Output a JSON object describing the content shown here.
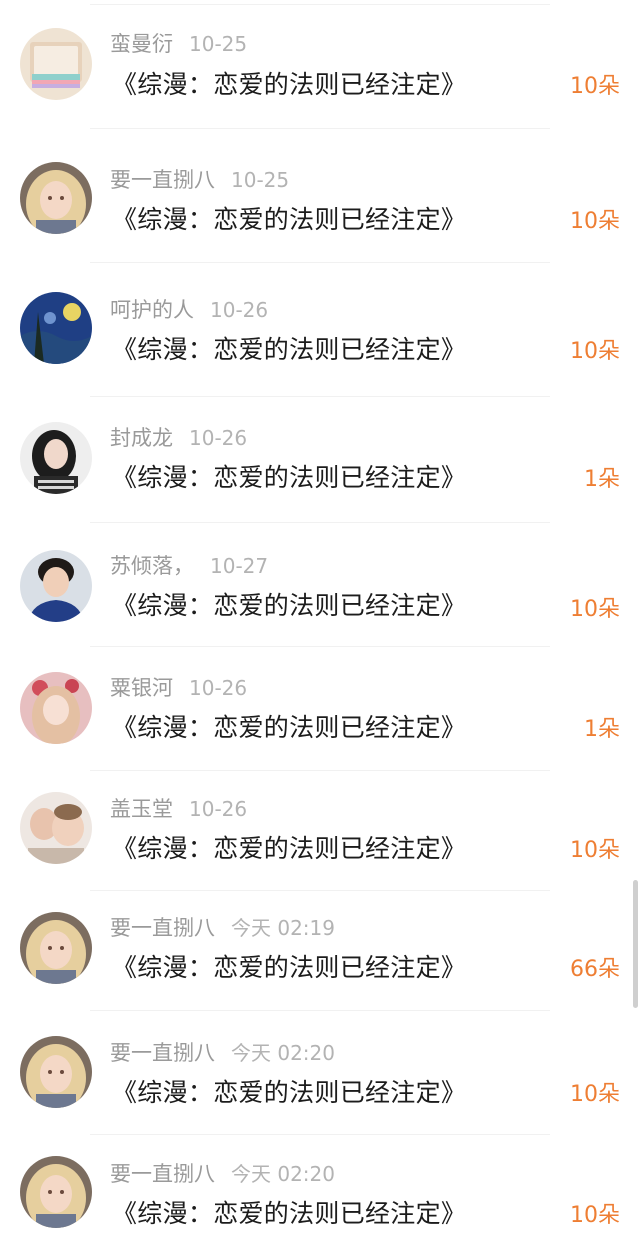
{
  "records": [
    {
      "user": "蛮曼衍",
      "time": "10-25",
      "book": "《综漫：恋爱的法则已经注定》",
      "amount": "10朵",
      "avatar": "notebook-avatar"
    },
    {
      "user": "要一直捌八",
      "time": "10-25",
      "book": "《综漫：恋爱的法则已经注定》",
      "amount": "10朵",
      "avatar": "anime-girl-avatar"
    },
    {
      "user": "呵护的人",
      "time": "10-26",
      "book": "《综漫：恋爱的法则已经注定》",
      "amount": "10朵",
      "avatar": "starry-night-avatar"
    },
    {
      "user": "封成龙",
      "time": "10-26",
      "book": "《综漫：恋爱的法则已经注定》",
      "amount": "1朵",
      "avatar": "girl-photo-avatar"
    },
    {
      "user": "苏倾落，",
      "time": "10-27",
      "book": "《综漫：恋爱的法则已经注定》",
      "amount": "10朵",
      "avatar": "boy-photo-avatar"
    },
    {
      "user": "粟银河",
      "time": "10-26",
      "book": "《综漫：恋爱的法则已经注定》",
      "amount": "1朵",
      "avatar": "flower-girl-avatar"
    },
    {
      "user": "盖玉堂",
      "time": "10-26",
      "book": "《综漫：恋爱的法则已经注定》",
      "amount": "10朵",
      "avatar": "kids-photo-avatar"
    },
    {
      "user": "要一直捌八",
      "time": "今天 02:19",
      "book": "《综漫：恋爱的法则已经注定》",
      "amount": "66朵",
      "avatar": "anime-girl-avatar"
    },
    {
      "user": "要一直捌八",
      "time": "今天 02:20",
      "book": "《综漫：恋爱的法则已经注定》",
      "amount": "10朵",
      "avatar": "anime-girl-avatar"
    },
    {
      "user": "要一直捌八",
      "time": "今天 02:20",
      "book": "《综漫：恋爱的法则已经注定》",
      "amount": "10朵",
      "avatar": "anime-girl-avatar"
    }
  ],
  "colors": {
    "amount": "#ee7e33",
    "meta": "#9a9a9a",
    "title": "#1c1c1c"
  }
}
